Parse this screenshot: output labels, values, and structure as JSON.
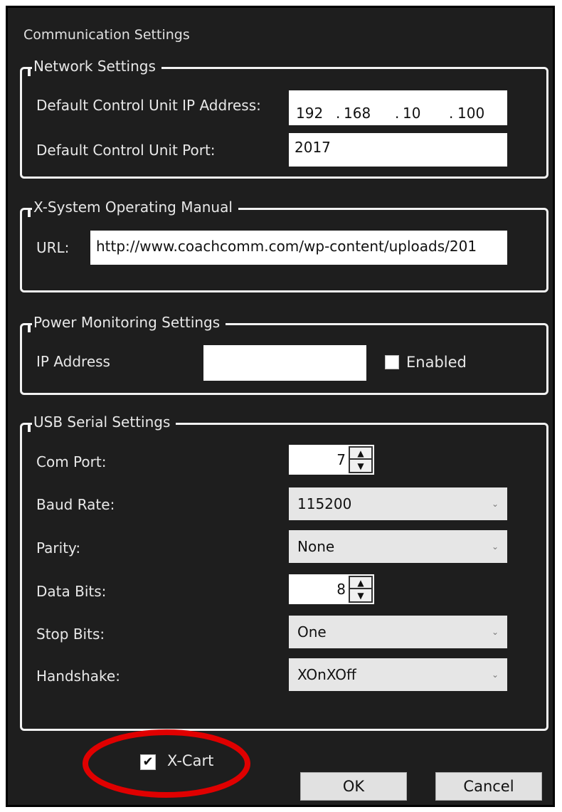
{
  "dialog": {
    "title": "Communication Settings"
  },
  "network": {
    "legend": "Network Settings",
    "ip_label": "Default Control Unit IP Address:",
    "ip_parts": [
      "192",
      "168",
      "10",
      "100"
    ],
    "port_label": "Default Control Unit Port:",
    "port_value": "2017"
  },
  "manual": {
    "legend": "X-System Operating Manual",
    "url_label": "URL:",
    "url_value": "http://www.coachcomm.com/wp-content/uploads/201"
  },
  "power": {
    "legend": "Power Monitoring Settings",
    "ip_label": "IP Address",
    "ip_value": "",
    "enabled_label": "Enabled",
    "enabled": false
  },
  "usb": {
    "legend": "USB Serial Settings",
    "com_port_label": "Com Port:",
    "com_port_value": "7",
    "baud_label": "Baud Rate:",
    "baud_value": "115200",
    "parity_label": "Parity:",
    "parity_value": "None",
    "data_bits_label": "Data Bits:",
    "data_bits_value": "8",
    "stop_bits_label": "Stop Bits:",
    "stop_bits_value": "One",
    "handshake_label": "Handshake:",
    "handshake_value": "XOnXOff"
  },
  "xcart": {
    "label": "X-Cart",
    "checked": true,
    "highlight_color": "#e00000"
  },
  "buttons": {
    "ok": "OK",
    "cancel": "Cancel"
  }
}
